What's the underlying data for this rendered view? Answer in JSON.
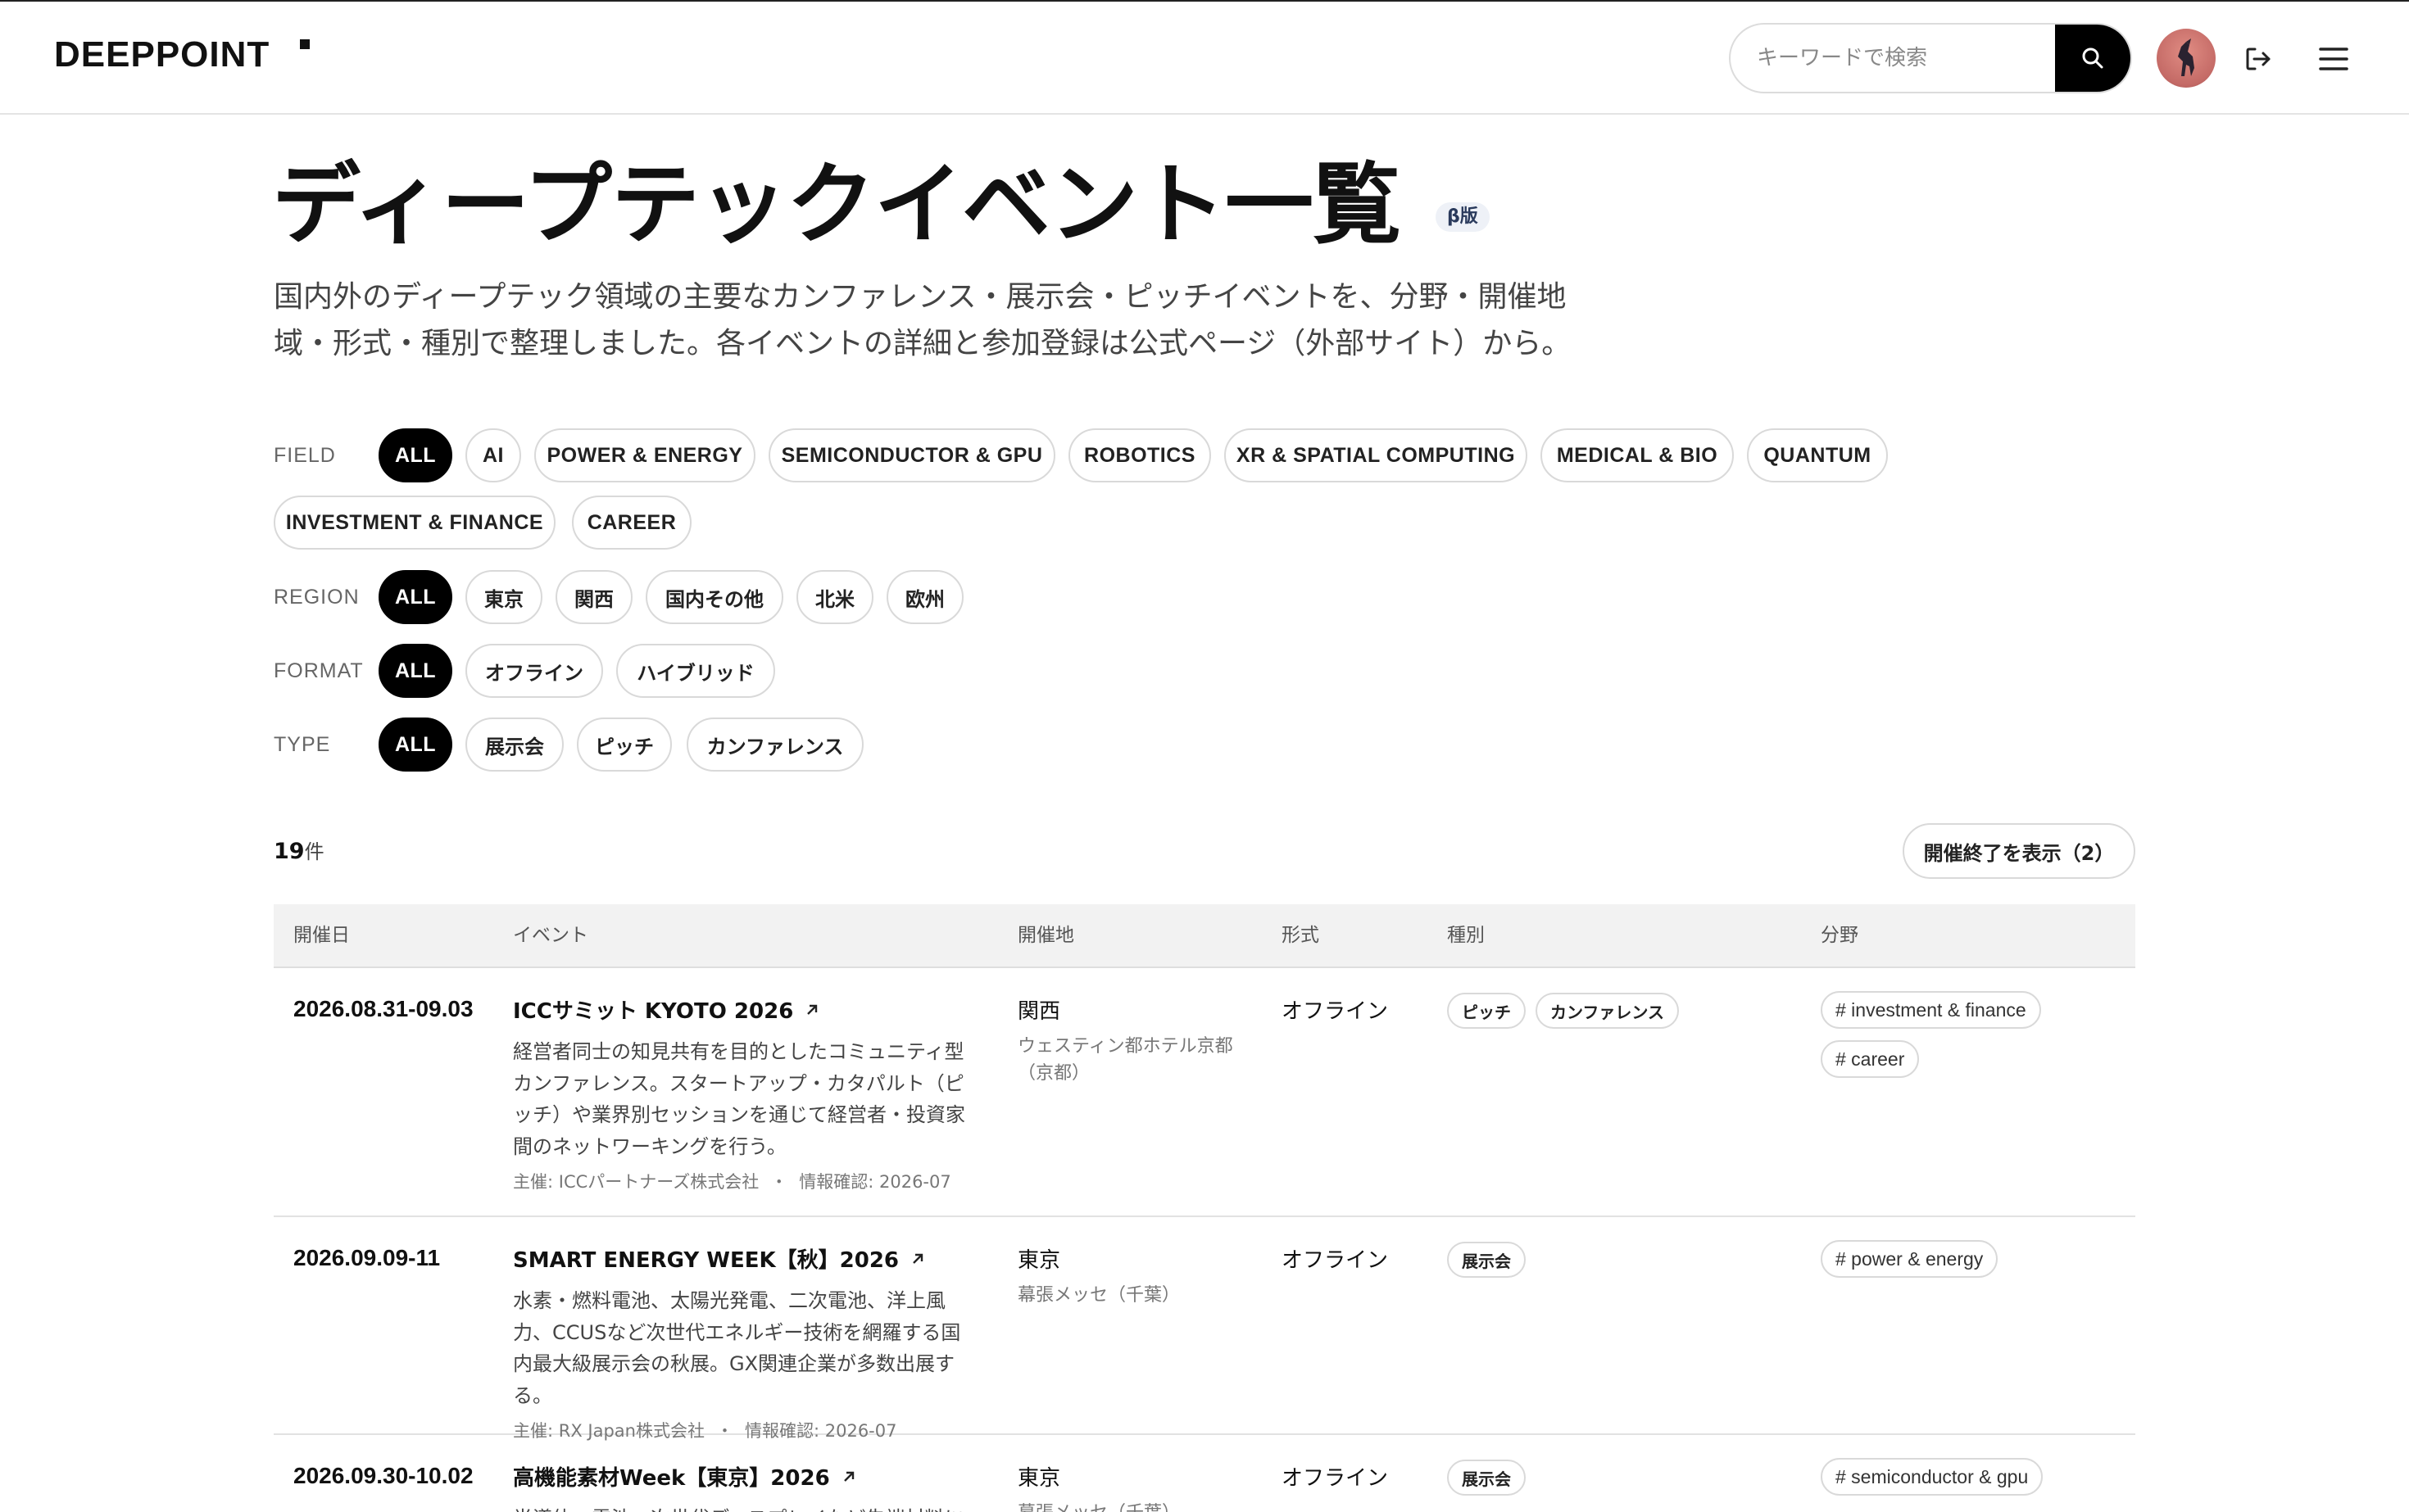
{
  "header": {
    "logo": "DEEPPOINT",
    "search_placeholder": "キーワードで検索"
  },
  "icons": [
    "search-icon",
    "avatar",
    "logout-icon",
    "menu-icon",
    "external-link-icon"
  ],
  "page": {
    "title": "ディープテックイベント一覧",
    "beta": "β版",
    "description": "国内外のディープテック領域の主要なカンファレンス・展示会・ピッチイベントを、分野・開催地域・形式・種別で整理しました。各イベントの詳細と参加登録は公式ページ（外部サイト）から。"
  },
  "filters": {
    "field": {
      "label": "FIELD",
      "options": [
        "ALL",
        "AI",
        "POWER & ENERGY",
        "SEMICONDUCTOR & GPU",
        "ROBOTICS",
        "XR & SPATIAL COMPUTING",
        "MEDICAL & BIO",
        "QUANTUM",
        "INVESTMENT & FINANCE",
        "CAREER"
      ],
      "selected": "ALL"
    },
    "region": {
      "label": "REGION",
      "options": [
        "ALL",
        "東京",
        "関西",
        "国内その他",
        "北米",
        "欧州"
      ],
      "selected": "ALL"
    },
    "format": {
      "label": "FORMAT",
      "options": [
        "ALL",
        "オフライン",
        "ハイブリッド"
      ],
      "selected": "ALL"
    },
    "type": {
      "label": "TYPE",
      "options": [
        "ALL",
        "展示会",
        "ピッチ",
        "カンファレンス"
      ],
      "selected": "ALL"
    }
  },
  "results": {
    "count": "19",
    "unit": "件",
    "show_past_label": "開催終了を表示（2）"
  },
  "table": {
    "headers": [
      "開催日",
      "イベント",
      "開催地",
      "形式",
      "種別",
      "分野"
    ],
    "rows": [
      {
        "date": "2026.08.31-09.03",
        "title": "ICCサミット KYOTO 2026",
        "desc": "経営者同士の知見共有を目的としたコミュニティ型カンファレンス。スタートアップ・カタパルト（ピッチ）や業界別セッションを通じて経営者・投資家間のネットワーキングを行う。",
        "organizer": "主催: ICCパートナーズ株式会社",
        "checked": "情報確認: 2026-07",
        "region": "関西",
        "venue": "ウェスティン都ホテル京都（京都）",
        "format": "オフライン",
        "types": [
          "ピッチ",
          "カンファレンス"
        ],
        "fields": [
          "# investment & finance",
          "# career"
        ]
      },
      {
        "date": "2026.09.09-11",
        "title": "SMART ENERGY WEEK【秋】2026",
        "desc": "水素・燃料電池、太陽光発電、二次電池、洋上風力、CCUSなど次世代エネルギー技術を網羅する国内最大級展示会の秋展。GX関連企業が多数出展する。",
        "organizer": "主催: RX Japan株式会社",
        "checked": "情報確認: 2026-07",
        "region": "東京",
        "venue": "幕張メッセ（千葉）",
        "format": "オフライン",
        "types": [
          "展示会"
        ],
        "fields": [
          "# power & energy"
        ]
      },
      {
        "date": "2026.09.30-10.02",
        "title": "高機能素材Week【東京】2026",
        "desc": "半導体、電池、次世代ディスプレイなど先端材料に",
        "organizer": "",
        "checked": "",
        "region": "東京",
        "venue": "幕張メッセ（千葉）",
        "format": "オフライン",
        "types": [
          "展示会"
        ],
        "fields": [
          "# semiconductor & gpu"
        ]
      }
    ]
  }
}
